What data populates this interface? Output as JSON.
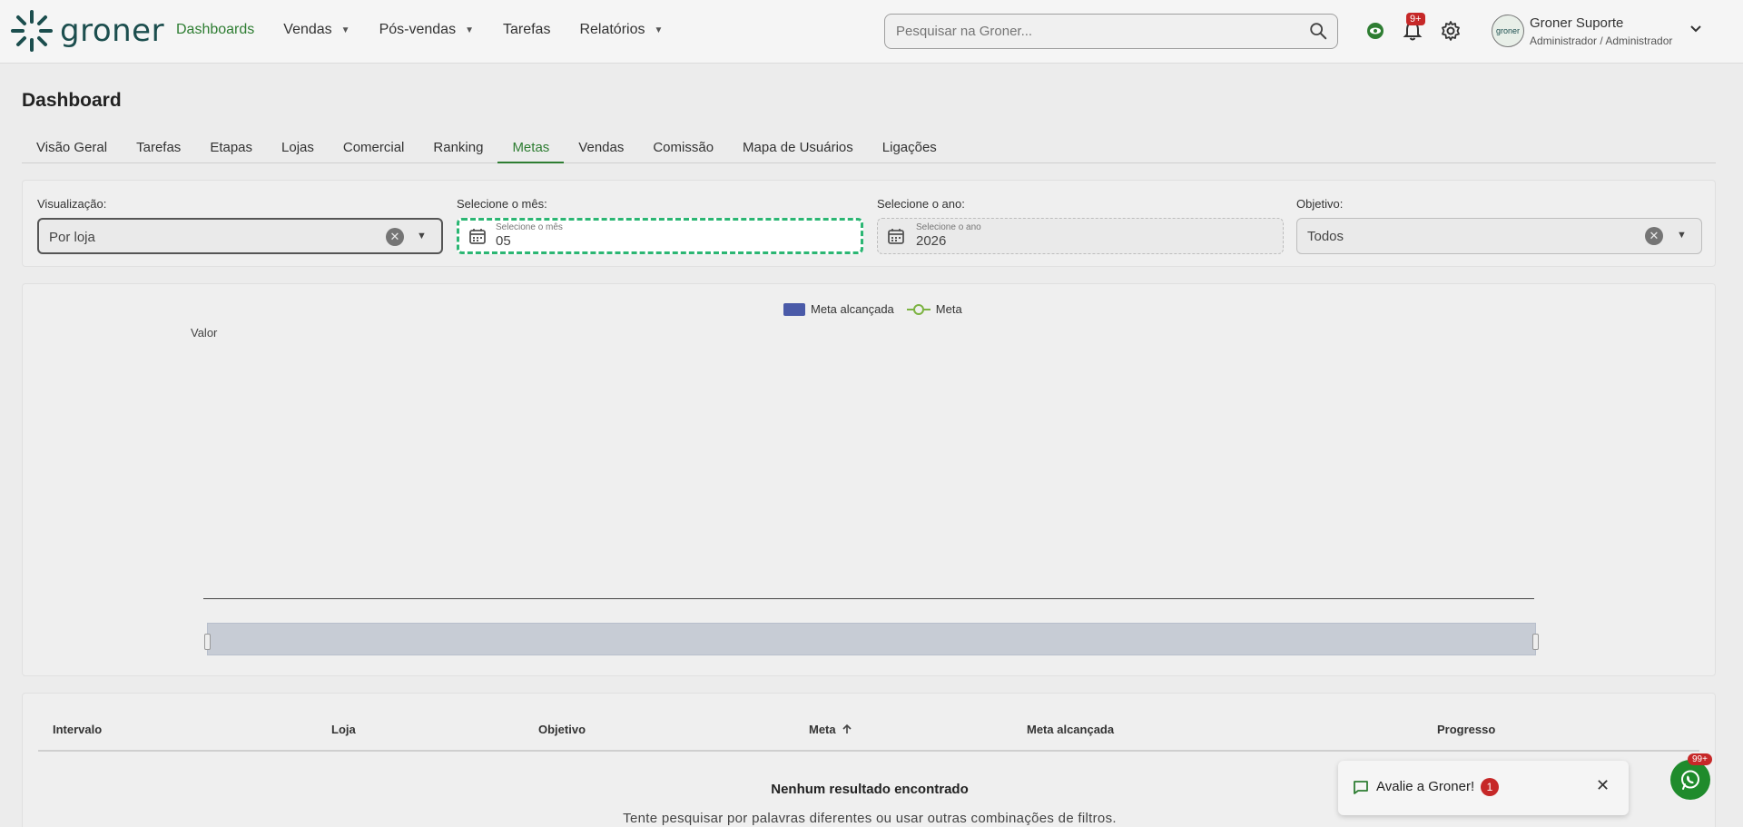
{
  "header": {
    "logo_text": "groner",
    "nav": [
      {
        "label": "Dashboards",
        "active": true,
        "dropdown": false
      },
      {
        "label": "Vendas",
        "active": false,
        "dropdown": true
      },
      {
        "label": "Pós-vendas",
        "active": false,
        "dropdown": true
      },
      {
        "label": "Tarefas",
        "active": false,
        "dropdown": false
      },
      {
        "label": "Relatórios",
        "active": false,
        "dropdown": true
      }
    ],
    "search_placeholder": "Pesquisar na Groner...",
    "notifications_badge": "9+",
    "user": {
      "name": "Groner Suporte",
      "role": "Administrador / Administrador",
      "avatar_text": "groner"
    }
  },
  "page": {
    "title": "Dashboard",
    "tabs": [
      "Visão Geral",
      "Tarefas",
      "Etapas",
      "Lojas",
      "Comercial",
      "Ranking",
      "Metas",
      "Vendas",
      "Comissão",
      "Mapa de Usuários",
      "Ligações"
    ],
    "active_tab": "Metas"
  },
  "filters": {
    "visualizacao": {
      "label": "Visualização:",
      "value": "Por loja"
    },
    "mes": {
      "label": "Selecione o mês:",
      "hint": "Selecione o mês",
      "value": "05"
    },
    "ano": {
      "label": "Selecione o ano:",
      "hint": "Selecione o ano",
      "value": "2026"
    },
    "objetivo": {
      "label": "Objetivo:",
      "value": "Todos"
    }
  },
  "chart_data": {
    "type": "bar",
    "categories": [],
    "series": [
      {
        "name": "Meta alcançada",
        "type": "bar",
        "values": []
      },
      {
        "name": "Meta",
        "type": "line",
        "values": []
      }
    ],
    "ylabel": "Valor",
    "legend": "top-center",
    "colors": {
      "Meta alcançada": "#4a5aa8",
      "Meta": "#7cb342"
    }
  },
  "table": {
    "columns": [
      "Intervalo",
      "Loja",
      "Objetivo",
      "Meta",
      "Meta alcançada",
      "Progresso"
    ],
    "sorted_column": "Meta",
    "empty_title": "Nenhum resultado encontrado",
    "empty_subtitle": "Tente pesquisar por palavras diferentes ou usar outras combinações de filtros."
  },
  "toast": {
    "text": "Avalie a Groner!",
    "count": "1"
  },
  "whatsapp": {
    "badge": "99+"
  },
  "colors": {
    "accent": "#2e7d32",
    "focus": "#2bb673",
    "badge": "#c62828"
  }
}
